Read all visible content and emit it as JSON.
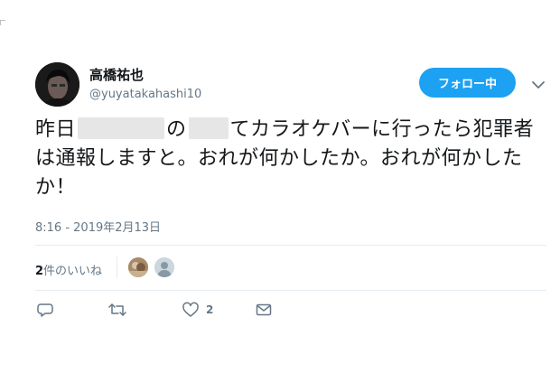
{
  "user": {
    "display_name": "高橋祐也",
    "username": "@yuyatakahashi10",
    "follow_label": "フォロー中"
  },
  "tweet": {
    "text_part1": "昨日",
    "text_part2": "の",
    "text_part3": "てカラオケバーに行ったら犯罪者は通報しますと。おれが何かしたか。おれが何かしたか！",
    "timestamp": "8:16 - 2019年2月13日"
  },
  "likes": {
    "count": "2",
    "label": "件のいいね"
  },
  "actions": {
    "like_count": "2"
  },
  "icons": {
    "reply": "reply-icon",
    "retweet": "retweet-icon",
    "like": "heart-icon",
    "message": "envelope-icon",
    "more": "chevron-down-icon"
  },
  "colors": {
    "accent": "#1da1f2",
    "secondary_text": "#657786",
    "divider": "#e6ecf0"
  }
}
